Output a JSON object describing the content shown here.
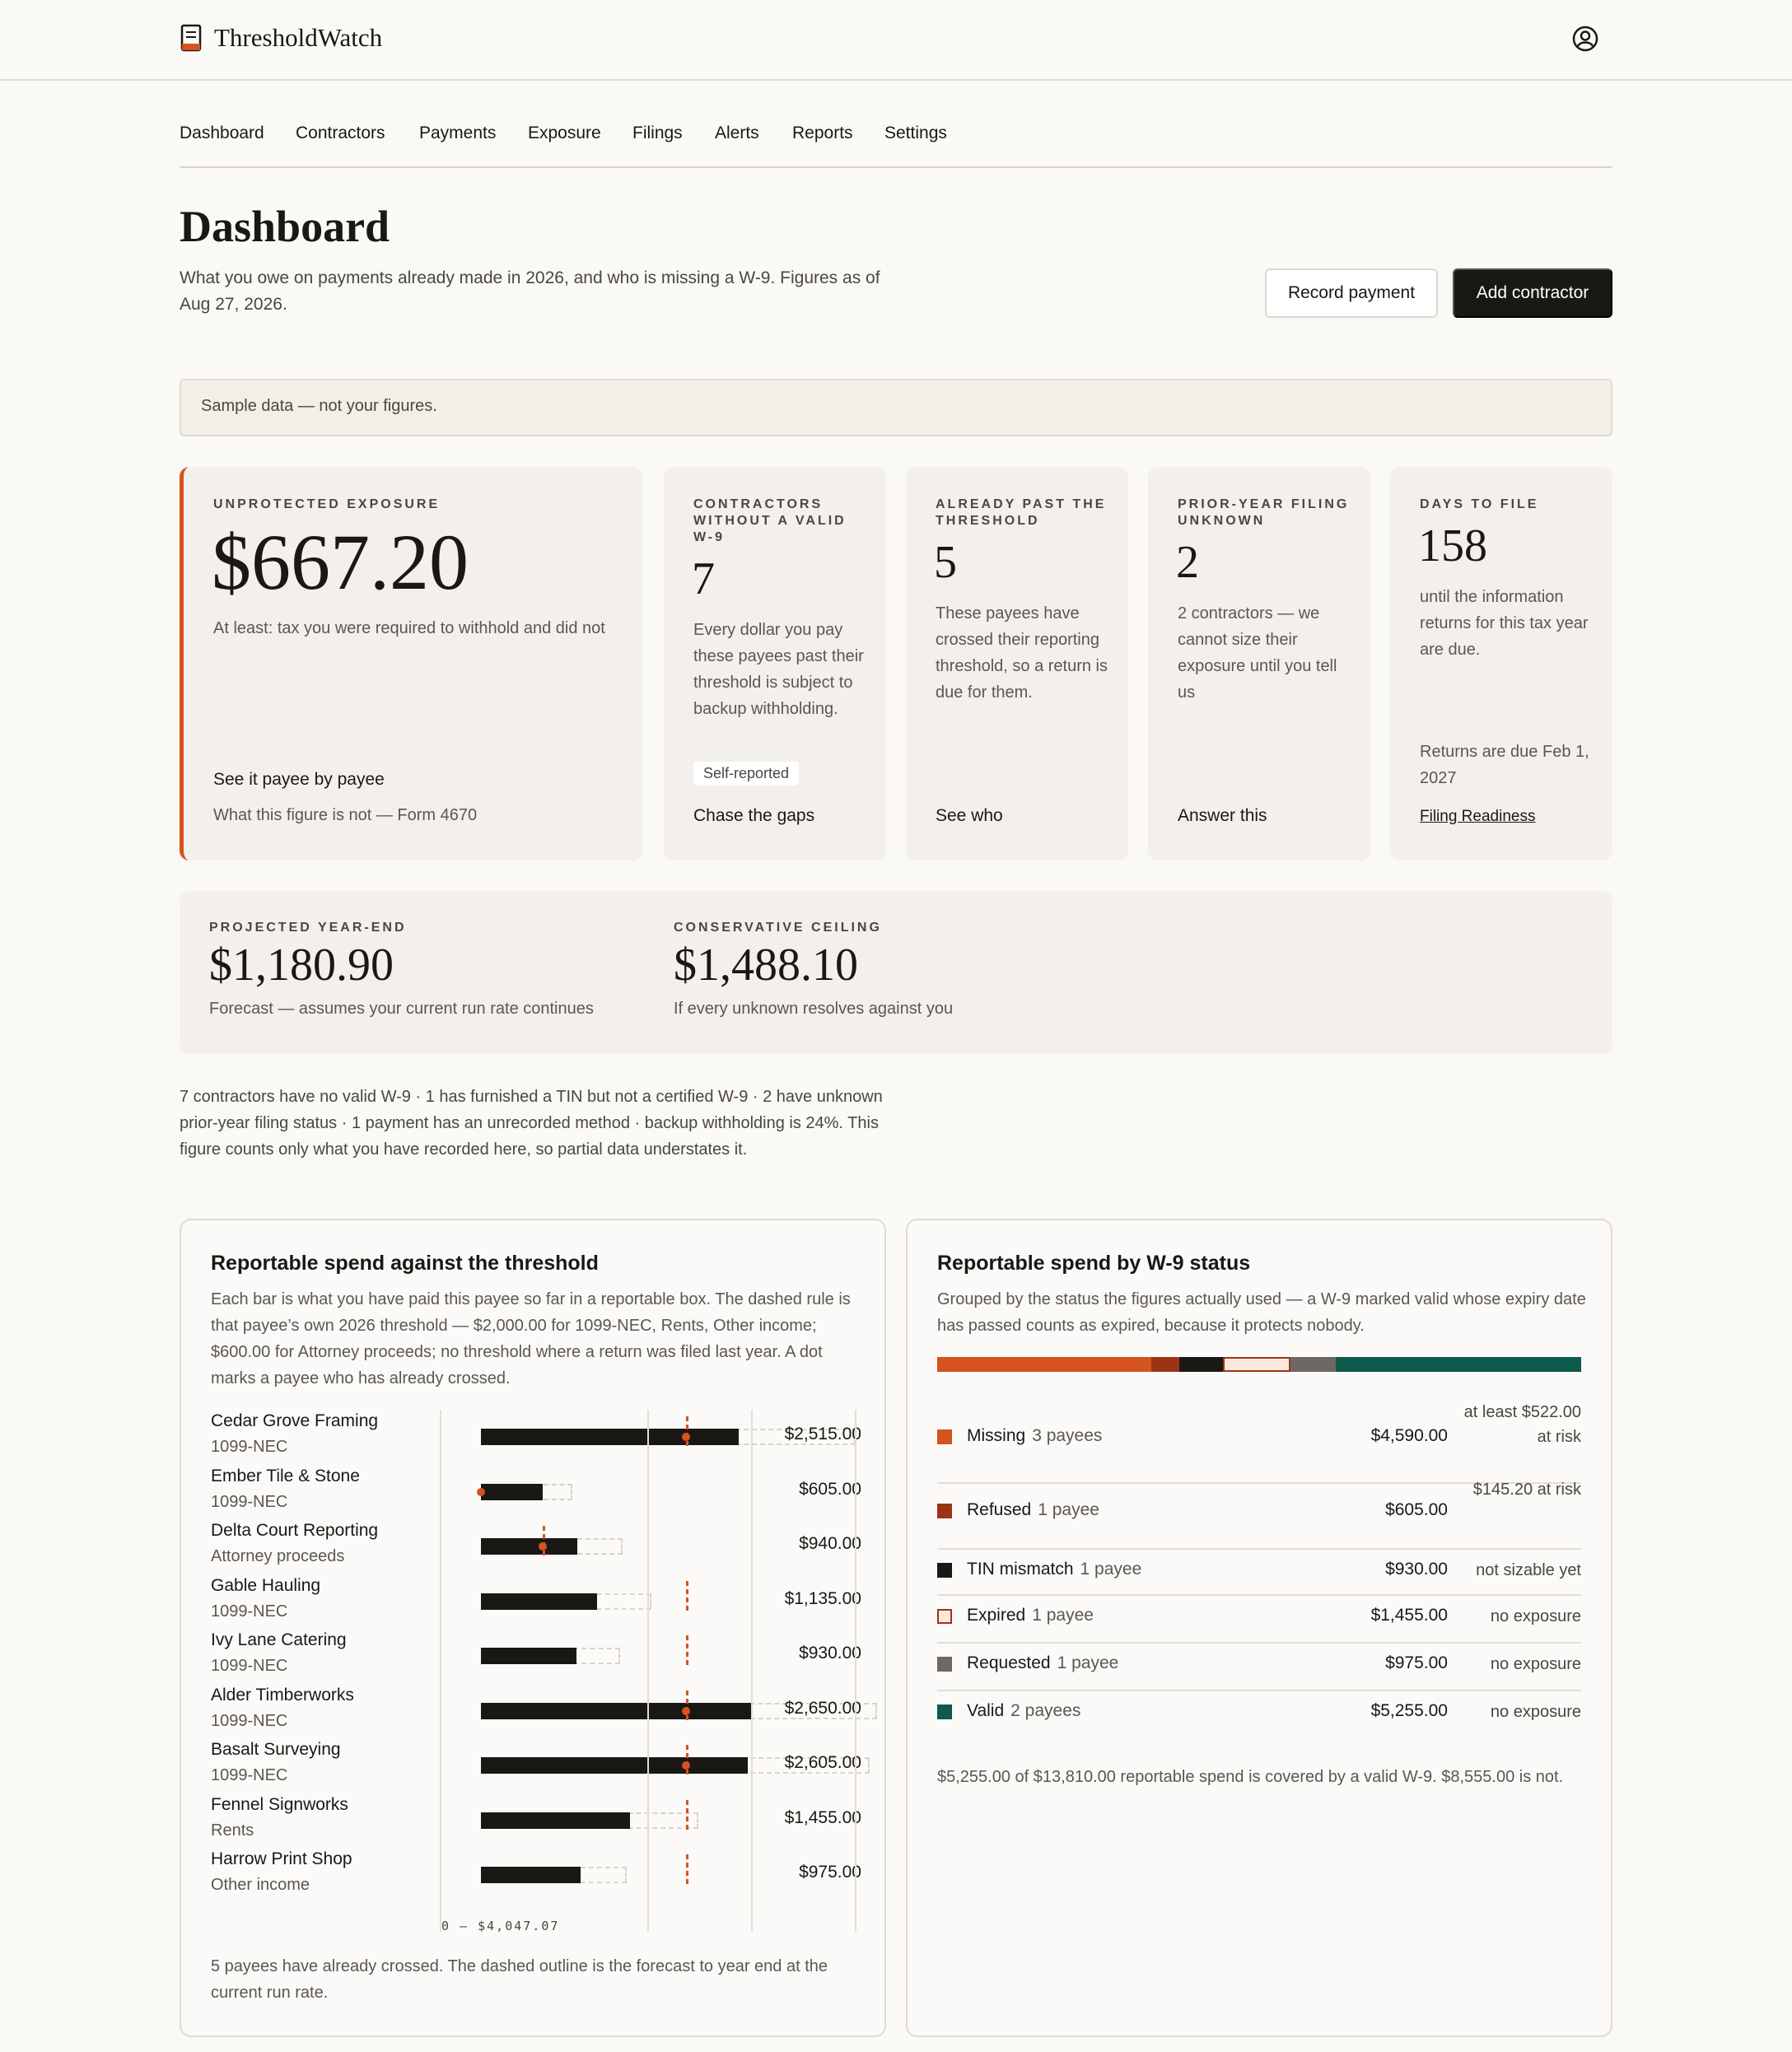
{
  "app": {
    "name": "ThresholdWatch"
  },
  "nav": [
    "Dashboard",
    "Contractors",
    "Payments",
    "Exposure",
    "Filings",
    "Alerts",
    "Reports",
    "Settings"
  ],
  "page": {
    "title": "Dashboard",
    "subtitle": "What you owe on payments already made in 2026, and who is missing a W-9. Figures as of Aug 27, 2026.",
    "record_payment": "Record payment",
    "add_contractor": "Add contractor",
    "banner": "Sample data — not your figures."
  },
  "kpis": {
    "exposure": {
      "label": "UNPROTECTED EXPOSURE",
      "value": "$667.20",
      "desc": "At least: tax you were required to withhold and did not",
      "link": "See it payee by payee",
      "note": "What this figure is not — Form 4670"
    },
    "no_w9": {
      "label": "CONTRACTORS WITHOUT A VALID W-9",
      "value": "7",
      "desc": "Every dollar you pay these payees past their threshold is subject to backup withholding.",
      "chip": "Self-reported",
      "link": "Chase the gaps"
    },
    "past": {
      "label": "ALREADY PAST THE THRESHOLD",
      "value": "5",
      "desc": "These payees have crossed their reporting threshold, so a return is due for them.",
      "link": "See who"
    },
    "prior": {
      "label": "PRIOR-YEAR FILING UNKNOWN",
      "value": "2",
      "desc": "2 contractors — we cannot size their exposure until you tell us",
      "link": "Answer this"
    },
    "days": {
      "label": "DAYS TO FILE",
      "value": "158",
      "desc": "until the information returns for this tax year are due.",
      "note": "Returns are due Feb 1, 2027",
      "link": "Filing Readiness"
    }
  },
  "projection": {
    "year_end_label": "PROJECTED YEAR-END",
    "year_end_value": "$1,180.90",
    "year_end_desc": "Forecast — assumes your current run rate continues",
    "ceiling_label": "CONSERVATIVE CEILING",
    "ceiling_value": "$1,488.10",
    "ceiling_desc": "If every unknown resolves against you"
  },
  "summary": "7 contractors have no valid W-9 · 1 has furnished a TIN but not a certified W-9 · 2 have unknown prior-year filing status · 1 payment has an unrecorded method · backup withholding is 24%. This figure counts only what you have recorded here, so partial data understates it.",
  "threshold_panel": {
    "title": "Reportable spend against the threshold",
    "desc": "Each bar is what you have paid this payee so far in a reportable box. The dashed rule is that payee’s own 2026 threshold — $2,000.00 for 1099-NEC, Rents, Other income; $600.00 for Attorney proceeds; no threshold where a return was filed last year. A dot marks a payee who has already crossed.",
    "axis_label": "0 — $4,047.07",
    "axis_max": 4047.07,
    "footer": "5 payees have already crossed. The dashed outline is the forecast to year end at the current run rate.",
    "payees": [
      {
        "name": "Cedar Grove Framing",
        "form": "1099-NEC",
        "paid": 2515.0,
        "paid_label": "$2,515.00",
        "forecast": 3650,
        "threshold": 2000,
        "crossed": true
      },
      {
        "name": "Ember Tile & Stone",
        "form": "1099-NEC",
        "paid": 605.0,
        "paid_label": "$605.00",
        "forecast": 890,
        "threshold": 0,
        "crossed": true
      },
      {
        "name": "Delta Court Reporting",
        "form": "Attorney proceeds",
        "paid": 940.0,
        "paid_label": "$940.00",
        "forecast": 1380,
        "threshold": 600,
        "crossed": true
      },
      {
        "name": "Gable Hauling",
        "form": "1099-NEC",
        "paid": 1135.0,
        "paid_label": "$1,135.00",
        "forecast": 1660,
        "threshold": 2000,
        "crossed": false
      },
      {
        "name": "Ivy Lane Catering",
        "form": "1099-NEC",
        "paid": 930.0,
        "paid_label": "$930.00",
        "forecast": 1360,
        "threshold": 2000,
        "crossed": false
      },
      {
        "name": "Alder Timberworks",
        "form": "1099-NEC",
        "paid": 2650.0,
        "paid_label": "$2,650.00",
        "forecast": 3860,
        "threshold": 2000,
        "crossed": true
      },
      {
        "name": "Basalt Surveying",
        "form": "1099-NEC",
        "paid": 2605.0,
        "paid_label": "$2,605.00",
        "forecast": 3790,
        "threshold": 2000,
        "crossed": true
      },
      {
        "name": "Fennel Signworks",
        "form": "Rents",
        "paid": 1455.0,
        "paid_label": "$1,455.00",
        "forecast": 2120,
        "threshold": 2000,
        "crossed": false
      },
      {
        "name": "Harrow Print Shop",
        "form": "Other income",
        "paid": 975.0,
        "paid_label": "$975.00",
        "forecast": 1420,
        "threshold": 2000,
        "crossed": false
      }
    ]
  },
  "status_panel": {
    "title": "Reportable spend by W-9 status",
    "desc": "Grouped by the status the figures actually used — a W-9 marked valid whose expiry date has passed counts as expired, because it protects nobody.",
    "footer": "$5,255.00 of $13,810.00 reportable spend is covered by a valid W-9. $8,555.00 is not.",
    "statuses": [
      {
        "name": "Missing",
        "count": "3 payees",
        "amount": "$4,590.00",
        "value": 4590,
        "risk": "at least $522.00 at risk",
        "color": "#d4531f",
        "outline": false
      },
      {
        "name": "Refused",
        "count": "1 payee",
        "amount": "$605.00",
        "value": 605,
        "risk": "$145.20 at risk",
        "color": "#9c3414",
        "outline": false
      },
      {
        "name": "TIN mismatch",
        "count": "1 payee",
        "amount": "$930.00",
        "value": 930,
        "risk": "not sizable yet",
        "color": "#1a1815",
        "outline": false
      },
      {
        "name": "Expired",
        "count": "1 payee",
        "amount": "$1,455.00",
        "value": 1455,
        "risk": "no exposure",
        "color": "#fbe9df",
        "outline": true
      },
      {
        "name": "Requested",
        "count": "1 payee",
        "amount": "$975.00",
        "value": 975,
        "risk": "no exposure",
        "color": "#6f6761",
        "outline": false
      },
      {
        "name": "Valid",
        "count": "2 payees",
        "amount": "$5,255.00",
        "value": 5255,
        "risk": "no exposure",
        "color": "#0e5a4c",
        "outline": false
      }
    ]
  }
}
